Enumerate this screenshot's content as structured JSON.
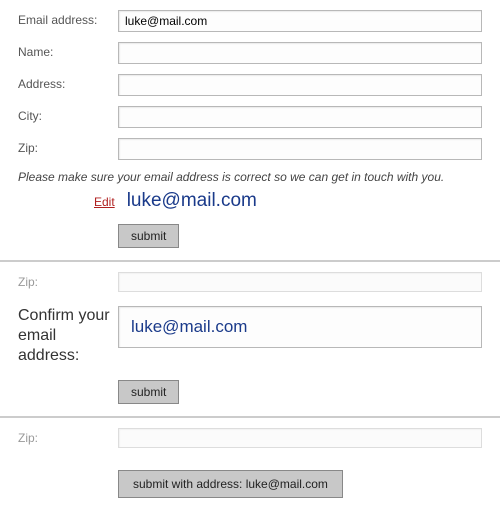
{
  "form1": {
    "fields": {
      "email": {
        "label": "Email address:",
        "value": "luke@mail.com"
      },
      "name": {
        "label": "Name:",
        "value": ""
      },
      "address": {
        "label": "Address:",
        "value": ""
      },
      "city": {
        "label": "City:",
        "value": ""
      },
      "zip": {
        "label": "Zip:",
        "value": ""
      }
    },
    "hint": "Please make sure your email address is correct so we can get in touch with you.",
    "edit_label": "Edit",
    "echo_email": "luke@mail.com",
    "submit_label": "submit"
  },
  "form2": {
    "zip": {
      "label": "Zip:",
      "value": ""
    },
    "confirm_label": "Confirm your email address:",
    "confirm_value": "luke@mail.com",
    "submit_label": "submit"
  },
  "form3": {
    "zip": {
      "label": "Zip:",
      "value": ""
    },
    "submit_label": "submit with address: luke@mail.com"
  }
}
